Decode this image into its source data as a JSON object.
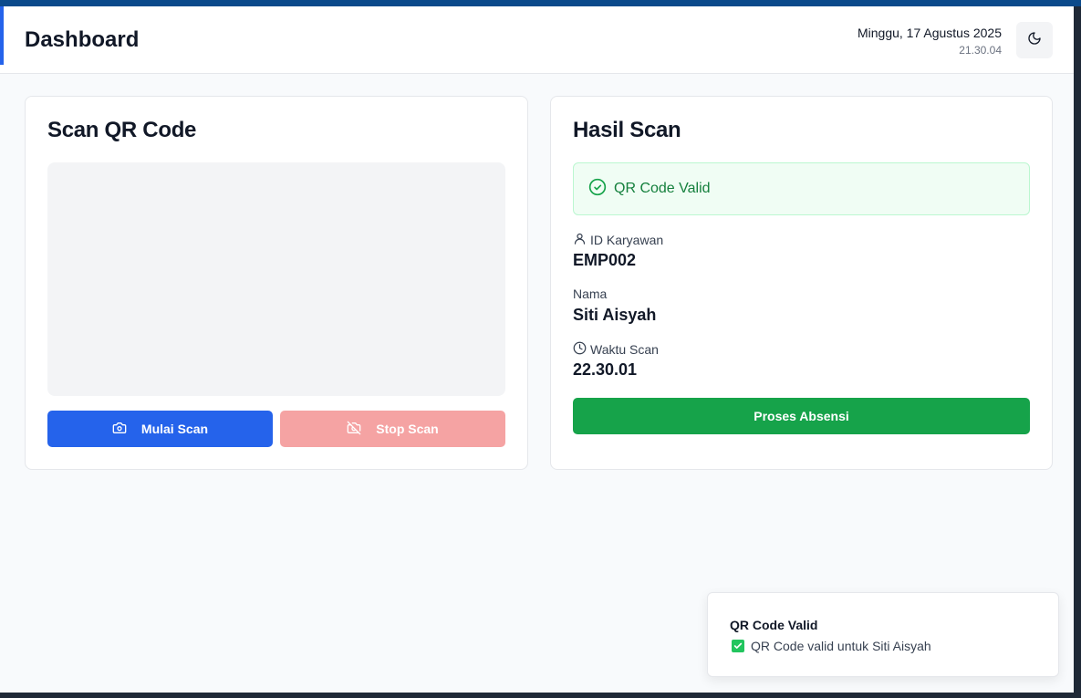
{
  "header": {
    "title": "Dashboard",
    "date": "Minggu, 17 Agustus 2025",
    "time": "21.30.04",
    "theme_icon": "moon-icon"
  },
  "scanner": {
    "title": "Scan QR Code",
    "start_label": "Mulai Scan",
    "start_icon": "camera-icon",
    "stop_label": "Stop Scan",
    "stop_icon": "camera-off-icon"
  },
  "result": {
    "title": "Hasil Scan",
    "status": "QR Code Valid",
    "status_icon": "check-circle-icon",
    "fields": [
      {
        "label": "ID Karyawan",
        "value": "EMP002",
        "icon": "user-icon"
      },
      {
        "label": "Nama",
        "value": "Siti Aisyah",
        "icon": ""
      },
      {
        "label": "Waktu Scan",
        "value": "22.30.01",
        "icon": "clock-icon"
      }
    ],
    "process_label": "Proses Absensi"
  },
  "toast": {
    "title": "QR Code Valid",
    "message": "QR Code valid untuk Siti Aisyah",
    "icon": "check-mark-emoji-icon"
  },
  "colors": {
    "primary": "#2563eb",
    "danger_disabled": "#f5a3a3",
    "success": "#16a34a",
    "success_bg": "#f0fdf4",
    "success_text": "#15803d"
  }
}
